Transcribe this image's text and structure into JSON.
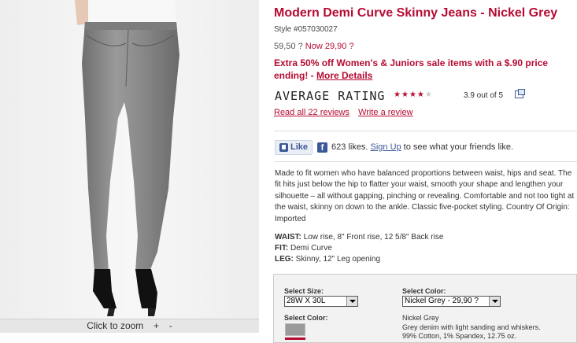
{
  "image": {
    "zoom_label": "Click to zoom",
    "zoom_in": "+",
    "zoom_out": "-"
  },
  "product": {
    "title": "Modern Demi Curve Skinny Jeans - Nickel Grey",
    "style": "Style #057030027",
    "price_old": "59,50 ?",
    "price_now": "Now 29,90 ?",
    "promo_text": "Extra 50% off Women's & Juniors sale items with a $.90 price ending! - ",
    "promo_link": "More Details"
  },
  "rating": {
    "label": "AVERAGE RATING",
    "stars_filled": 4,
    "stars_total": 5,
    "star_glyph": "★",
    "text": "3.9 out of 5",
    "read_reviews": "Read all 22 reviews",
    "write_review": "Write a review"
  },
  "facebook": {
    "like_label": "Like",
    "likes_text": "623 likes.",
    "signup_label": "Sign Up",
    "suffix_text": "to see what your friends like."
  },
  "description": "Made to fit women who have balanced proportions between waist, hips and seat. The fit hits just below the hip to flatter your waist, smooth your shape and lengthen your silhouette – all without gapping, pinching or revealing. Comfortable and not too tight at the waist, skinny on down to the ankle. Classic five-pocket styling. Country Of Origin: Imported",
  "specs": [
    {
      "key": "WAIST:",
      "value": "Low rise, 8\" Front rise, 12 5/8\" Back rise"
    },
    {
      "key": "FIT:",
      "value": "Demi Curve"
    },
    {
      "key": "LEG:",
      "value": "Skinny, 12\" Leg opening"
    }
  ],
  "selection": {
    "size_label": "Select Size:",
    "size_value": "28W X 30L",
    "color_label": "Select Color:",
    "color_value": "Nickel Grey - 29,90 ?",
    "swatch_label": "Select Color:",
    "color_name": "Nickel Grey",
    "color_desc": "Grey denim with light sanding and whiskers.",
    "color_fabric": "99% Cotton, 1% Spandex, 12.75 oz."
  },
  "colors": {
    "accent": "#b50b32",
    "facebook": "#3b5998",
    "denim": "#8a8a8a"
  }
}
